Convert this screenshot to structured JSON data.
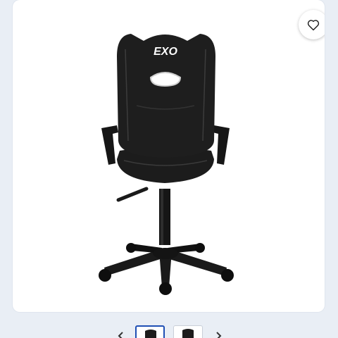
{
  "product": {
    "brand_logo_text": "EXO",
    "image_name": "black-gaming-chair"
  },
  "favorite": {
    "icon": "heart-outline-icon",
    "state": "not-favorited"
  },
  "gallery": {
    "thumbnails": [
      {
        "selected": true
      },
      {
        "selected": false
      }
    ],
    "prev_icon": "chevron-left-icon",
    "next_icon": "chevron-right-icon"
  },
  "colors": {
    "background": "#e9eef5",
    "card": "#ffffff",
    "chair": "#1b1b1b",
    "selected_border": "#1f4fb4"
  }
}
